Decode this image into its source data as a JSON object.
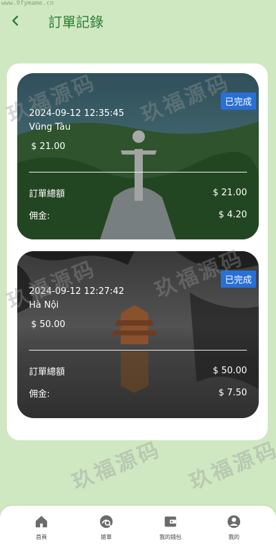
{
  "header": {
    "title": "訂單記錄",
    "site_mark": "www.9fymame.cn"
  },
  "orders": [
    {
      "status": "已完成",
      "time": "2024-09-12 12:35:45",
      "city": "Vũng Tàu",
      "price": "$ 21.00",
      "total_label": "訂單總額",
      "total_value": "$ 21.00",
      "commission_label": "佣金:",
      "commission_value": "$ 4.20"
    },
    {
      "status": "已完成",
      "time": "2024-09-12 12:27:42",
      "city": "Hà Nội",
      "price": "$ 50.00",
      "total_label": "訂單總額",
      "total_value": "$ 50.00",
      "commission_label": "佣金:",
      "commission_value": "$ 7.50"
    }
  ],
  "watermark": "玖福源码",
  "tabbar": [
    {
      "label": "首頁",
      "icon": "home-icon"
    },
    {
      "label": "搶單",
      "icon": "grab-order-icon"
    },
    {
      "label": "我的錢包",
      "icon": "wallet-icon"
    },
    {
      "label": "我的",
      "icon": "profile-icon"
    }
  ],
  "colors": {
    "background": "#cfe8c2",
    "title": "#2e7d32",
    "badge": "#2a6fd6"
  }
}
